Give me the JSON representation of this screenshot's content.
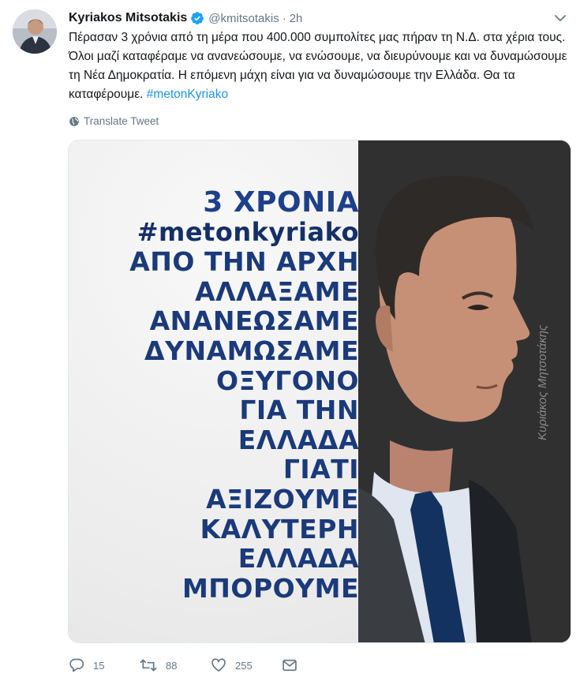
{
  "tweet": {
    "author_name": "Kyriakos Mitsotakis",
    "handle": "@kmitsotakis",
    "separator": "·",
    "time": "2h",
    "text": "Πέρασαν 3 χρόνια από τη μέρα που 400.000 συμπολίτες μας πήραν τη Ν.Δ. στα χέρια τους. Όλοι μαζί καταφέραμε να ανανεώσουμε, να ενώσουμε, να διευρύνουμε και να δυναμώσουμε τη Νέα Δημοκρατία. Η επόμενη μάχη είναι για να δυναμώσουμε την Ελλάδα. Θα τα καταφέρουμε. ",
    "hashtag": "#metonKyriako",
    "translate_label": "Translate Tweet"
  },
  "media": {
    "slogan_lines": [
      "3 ΧΡΟΝΙΑ",
      "#metonkyriako",
      "ΑΠΟ ΤΗΝ ΑΡΧΗ",
      "ΑΛΛΑΞΑΜΕ",
      "ΑΝΑΝΕΩΣΑΜΕ",
      "ΔΥΝΑΜΩΣΑΜΕ",
      "ΟΞΥΓΟΝΟ",
      "ΓΙΑ ΤΗΝ",
      "ΕΛΛΑΔΑ",
      "ΓΙΑΤΙ",
      "ΑΞΙΖΟΥΜΕ",
      "ΚΑΛΥΤΕΡΗ",
      "ΕΛΛΑΔΑ",
      "ΜΠΟΡΟΥΜΕ"
    ],
    "signature": "Κυριάκος Μητσοτάκης"
  },
  "actions": {
    "reply_count": "15",
    "retweet_count": "88",
    "like_count": "255"
  },
  "colors": {
    "link": "#1b95e0",
    "muted": "#657786",
    "slogan": "#1a3a7a",
    "verified": "#1da1f2"
  },
  "icons": [
    "verified-badge-icon",
    "chevron-down-icon",
    "globe-icon",
    "reply-icon",
    "retweet-icon",
    "like-icon",
    "direct-message-icon"
  ]
}
